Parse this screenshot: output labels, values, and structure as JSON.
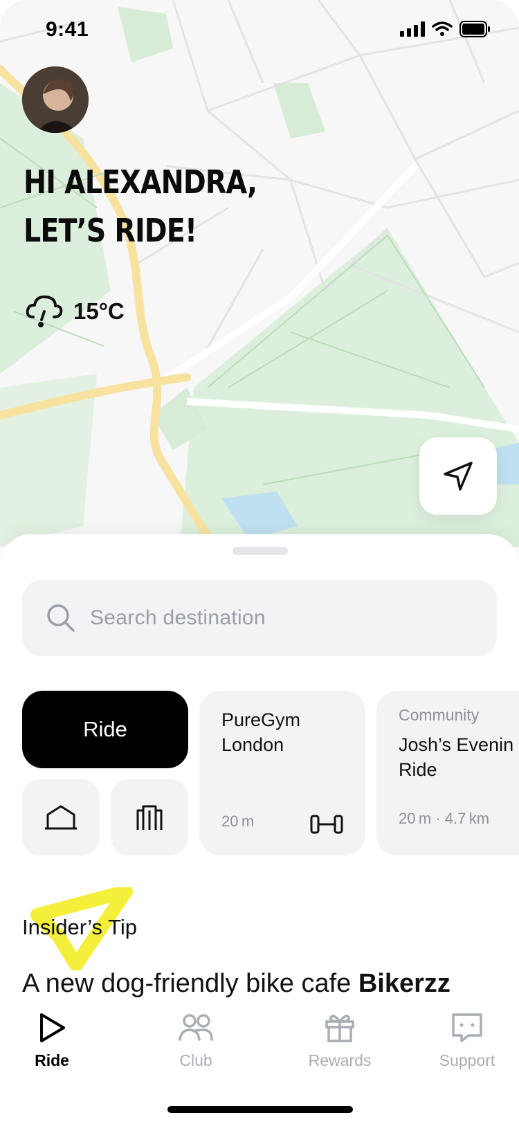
{
  "status": {
    "time": "9:41"
  },
  "greeting": {
    "line1": "HI ALEXANDRA,",
    "line2": "LET’S RIDE!"
  },
  "weather": {
    "icon": "cloud-rain-icon",
    "temp": "15°C"
  },
  "search": {
    "placeholder": "Search destination"
  },
  "quick": {
    "ride_label": "Ride",
    "home_icon": "home-icon",
    "work_icon": "building-icon",
    "cards": [
      {
        "title_line1": "PureGym",
        "title_line2": "London",
        "meta": "20 m",
        "icon": "dumbbell-icon"
      },
      {
        "category": "Community",
        "title_line1": "Josh’s Evenin",
        "title_line2": "Ride",
        "meta": "20 m · 4.7 km"
      }
    ]
  },
  "tip": {
    "heading": "Insider’s Tip",
    "text_start": "A new dog-friendly bike cafe ",
    "text_bold": "Bikerzz"
  },
  "tabs": [
    {
      "label": "Ride",
      "icon": "play-icon",
      "active": true
    },
    {
      "label": "Club",
      "icon": "users-icon",
      "active": false
    },
    {
      "label": "Rewards",
      "icon": "gift-icon",
      "active": false
    },
    {
      "label": "Support",
      "icon": "chat-icon",
      "active": false
    }
  ],
  "colors": {
    "accent": "#f4ef3a",
    "map_green": "#dcefdc",
    "map_road": "#fbe7a8",
    "inactive": "#a9adb4"
  }
}
